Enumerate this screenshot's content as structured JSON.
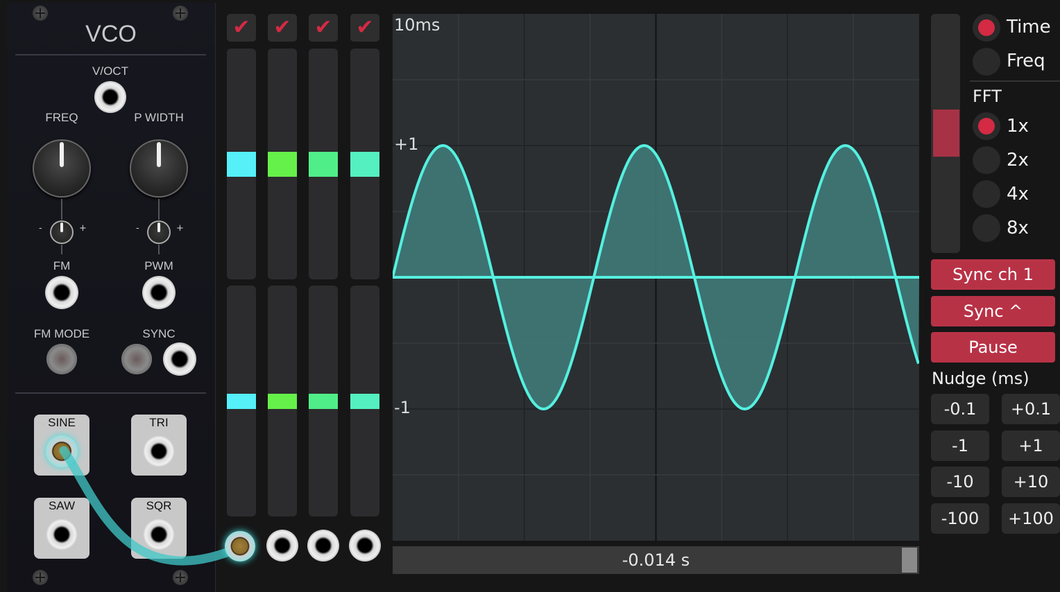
{
  "vco": {
    "title": "VCO",
    "voct_label": "V/OCT",
    "freq_label": "FREQ",
    "pwidth_label": "P WIDTH",
    "fm_label": "FM",
    "pwm_label": "PWM",
    "fm_mode_label": "FM MODE",
    "sync_label": "SYNC",
    "minus": "-",
    "plus": "+",
    "outputs": {
      "sine": "SINE",
      "tri": "TRI",
      "saw": "SAW",
      "sqr": "SQR"
    }
  },
  "channels": [
    {
      "enabled": true,
      "check": "✔",
      "color": "#55f0f8",
      "upper_level": 0.5,
      "lower_level": 0.5
    },
    {
      "enabled": true,
      "check": "✔",
      "color": "#66f04a",
      "upper_level": 0.5,
      "lower_level": 0.5
    },
    {
      "enabled": true,
      "check": "✔",
      "color": "#50ee88",
      "upper_level": 0.5,
      "lower_level": 0.5
    },
    {
      "enabled": true,
      "check": "✔",
      "color": "#55f0c0",
      "upper_level": 0.5,
      "lower_level": 0.5
    }
  ],
  "scope": {
    "timebase_label": "10ms",
    "plus_one_label": "+1",
    "minus_one_label": "-1",
    "cursor_value": "-0.014 s",
    "wave_color": "#55f0e0",
    "fill_color": "#3f7a78"
  },
  "right_panel": {
    "mode_options": [
      {
        "label": "Time",
        "selected": true
      },
      {
        "label": "Freq",
        "selected": false
      }
    ],
    "fft_label": "FFT",
    "fft_options": [
      {
        "label": "1x",
        "selected": true
      },
      {
        "label": "2x",
        "selected": false
      },
      {
        "label": "4x",
        "selected": false
      },
      {
        "label": "8x",
        "selected": false
      }
    ],
    "sync_ch_label": "Sync ch 1",
    "sync_edge_label": "Sync ^",
    "pause_label": "Pause",
    "nudge_label": "Nudge (ms)",
    "nudge_buttons": [
      "-0.1",
      "+0.1",
      "-1",
      "+1",
      "-10",
      "+10",
      "-100",
      "+100"
    ],
    "accent_color": "#b83246"
  }
}
